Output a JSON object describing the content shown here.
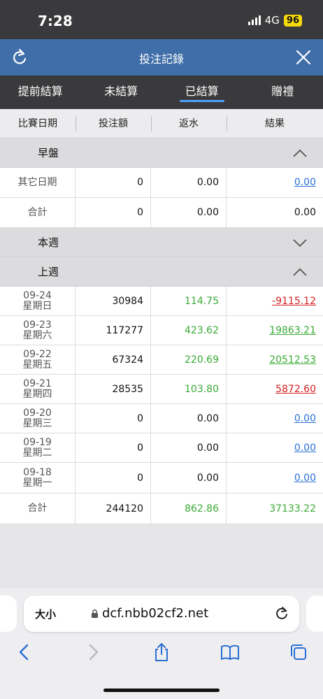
{
  "status": {
    "time": "7:28",
    "network": "4G",
    "battery": "96"
  },
  "header": {
    "title": "投注記錄"
  },
  "tabs": [
    {
      "label": "提前結算"
    },
    {
      "label": "未結算"
    },
    {
      "label": "已結算",
      "active": true
    },
    {
      "label": "贈禮"
    }
  ],
  "columns": [
    "比賽日期",
    "投注額",
    "返水",
    "結果"
  ],
  "sections": {
    "early": {
      "title": "早盤",
      "rows": [
        {
          "date": "其它日期",
          "amount": "0",
          "rebate": "0.00",
          "result": "0.00"
        }
      ],
      "total": {
        "label": "合計",
        "amount": "0",
        "rebate": "0.00",
        "result": "0.00"
      }
    },
    "this_week": {
      "title": "本週"
    },
    "last_week": {
      "title": "上週",
      "rows": [
        {
          "date": "09-24",
          "day": "星期日",
          "amount": "30984",
          "rebate": "114.75",
          "result": "-9115.12"
        },
        {
          "date": "09-23",
          "day": "星期六",
          "amount": "117277",
          "rebate": "423.62",
          "result": "19863.21"
        },
        {
          "date": "09-22",
          "day": "星期五",
          "amount": "67324",
          "rebate": "220.69",
          "result": "20512.53"
        },
        {
          "date": "09-21",
          "day": "星期四",
          "amount": "28535",
          "rebate": "103.80",
          "result": "5872.60"
        },
        {
          "date": "09-20",
          "day": "星期三",
          "amount": "0",
          "rebate": "0.00",
          "result": "0.00"
        },
        {
          "date": "09-19",
          "day": "星期二",
          "amount": "0",
          "rebate": "0.00",
          "result": "0.00"
        },
        {
          "date": "09-18",
          "day": "星期一",
          "amount": "0",
          "rebate": "0.00",
          "result": "0.00"
        }
      ],
      "total": {
        "label": "合計",
        "amount": "244120",
        "rebate": "862.86",
        "result": "37133.22"
      }
    }
  },
  "browser": {
    "text_size_label": "大小",
    "url": "dcf.nbb02cf2.net"
  },
  "colors": {
    "header_blue": "#3f6ea8",
    "green": "#3aaa35",
    "red": "#d62020",
    "link_blue": "#2a6fd6"
  }
}
